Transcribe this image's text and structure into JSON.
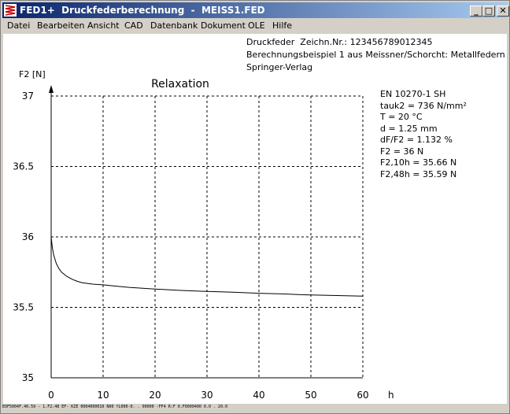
{
  "window": {
    "title": "FED1+  Druckfederberechnung  -  MEISS1.FED",
    "minimize": "_",
    "maximize": "□",
    "close": "✕"
  },
  "menu": [
    "Datei",
    "Bearbeiten",
    "Ansicht",
    "CAD",
    "Datenbank",
    "Dokument",
    "OLE",
    "Hilfe"
  ],
  "header": {
    "line1": "Druckfeder  Zeichn.Nr.: 123456789012345",
    "line2": "Berechnungsbeispiel 1 aus Meissner/Schorcht: Metallfedern",
    "line3": "Springer-Verlag"
  },
  "params": [
    "EN 10270-1 SH",
    "tauk2 = 736 N/mm²",
    "T = 20 °C",
    "d = 1.25 mm",
    "dF/F2 = 1.132 %",
    "F2 = 36 N",
    "F2,10h = 35.66 N",
    "F2,48h = 35.59 N"
  ],
  "statusbar": "EOF5004F.40.59 - 1.F2.48 EF- KZE 0004000010 N00 fL000-0. . 00000 -FF4 R:F 0.F0000400  0.0 . 20.0",
  "chart_data": {
    "type": "line",
    "title": "Relaxation",
    "ylabel": "F2 [N]",
    "xlabel": "h",
    "xlim": [
      0,
      60
    ],
    "ylim": [
      35,
      37
    ],
    "xticks": [
      "0",
      "10",
      "20",
      "30",
      "40",
      "50",
      "60"
    ],
    "yticks": [
      "35",
      "35.5",
      "36",
      "36.5",
      "37"
    ],
    "grid": true,
    "series": [
      {
        "x": [
          0,
          0.25,
          0.5,
          1,
          1.5,
          2,
          3,
          4,
          5,
          6,
          8,
          10,
          12,
          15,
          20,
          25,
          30,
          35,
          40,
          45,
          48,
          50,
          55,
          60
        ],
        "y": [
          36,
          35.92,
          35.87,
          35.81,
          35.775,
          35.75,
          35.72,
          35.7,
          35.685,
          35.675,
          35.665,
          35.66,
          35.652,
          35.642,
          35.63,
          35.62,
          35.613,
          35.607,
          35.6,
          35.595,
          35.59,
          35.588,
          35.584,
          35.58
        ]
      }
    ]
  }
}
